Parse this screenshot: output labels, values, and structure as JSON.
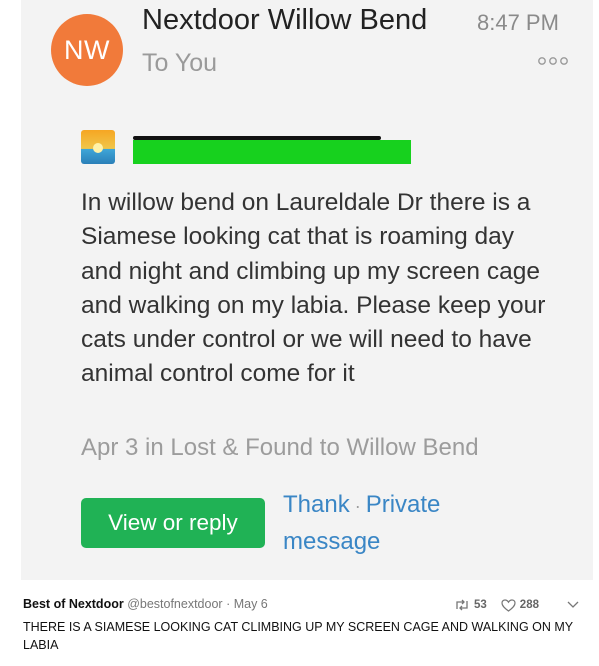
{
  "screenshot": {
    "avatar_initials": "NW",
    "sender": "Nextdoor Willow Bend",
    "time": "8:47 PM",
    "recipient": "To You",
    "post_body": "In willow bend on Laureldale Dr there is a Siamese looking cat that is roaming day and night and climbing up my screen cage and walking on my labia. Please keep your cats under control or we will need to have animal control come for it",
    "post_meta": "Apr 3 in Lost & Found to Willow Bend",
    "reply_label": "View or reply",
    "thank_label": "Thank",
    "separator": "·",
    "private_label": "Private message"
  },
  "tweet": {
    "name": "Best of Nextdoor",
    "handle": "@bestofnextdoor",
    "dot": "·",
    "date": "May 6",
    "retweets": "53",
    "likes": "288",
    "text": "THERE IS A SIAMESE LOOKING CAT CLIMBING UP MY SCREEN CAGE AND WALKING ON MY LABIA"
  },
  "colors": {
    "avatar": "#f17a3a",
    "reply_button": "#20b255",
    "link": "#3a86c5",
    "redaction": "#17d11e"
  },
  "icons": [
    "more-options-icon",
    "thumbnail-icon",
    "retweet-icon",
    "like-icon",
    "chevron-down-icon"
  ]
}
